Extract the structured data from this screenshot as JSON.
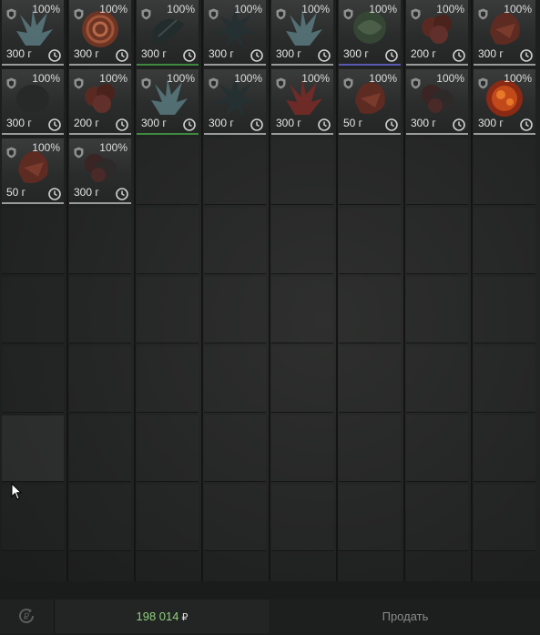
{
  "inventory": {
    "columns": 8,
    "rows": 8,
    "items": [
      {
        "condition": "100%",
        "weight": "300 г",
        "art": "blue-crystal-icon",
        "border": "white"
      },
      {
        "condition": "100%",
        "weight": "300 г",
        "art": "spiral-shell-icon",
        "border": "white"
      },
      {
        "condition": "100%",
        "weight": "300 г",
        "art": "dark-fern-icon",
        "border": "green"
      },
      {
        "condition": "100%",
        "weight": "300 г",
        "art": "dark-spiky-icon",
        "border": "white"
      },
      {
        "condition": "100%",
        "weight": "300 г",
        "art": "blue-crystal-icon",
        "border": "white"
      },
      {
        "condition": "100%",
        "weight": "300 г",
        "art": "green-orb-icon",
        "border": "blue"
      },
      {
        "condition": "100%",
        "weight": "200 г",
        "art": "red-cluster-icon",
        "border": "white"
      },
      {
        "condition": "100%",
        "weight": "300 г",
        "art": "red-rock-icon",
        "border": "white"
      },
      {
        "condition": "100%",
        "weight": "300 г",
        "art": "dark-blob-icon",
        "border": "white"
      },
      {
        "condition": "100%",
        "weight": "200 г",
        "art": "red-cluster-icon",
        "border": "white"
      },
      {
        "condition": "100%",
        "weight": "300 г",
        "art": "blue-crystal-icon",
        "border": "green"
      },
      {
        "condition": "100%",
        "weight": "300 г",
        "art": "dark-spiky-icon",
        "border": "white"
      },
      {
        "condition": "100%",
        "weight": "300 г",
        "art": "red-crystal-icon",
        "border": "white"
      },
      {
        "condition": "100%",
        "weight": "50 г",
        "art": "red-rock-icon",
        "border": "white"
      },
      {
        "condition": "100%",
        "weight": "300 г",
        "art": "dark-cluster-icon",
        "border": "white"
      },
      {
        "condition": "100%",
        "weight": "300 г",
        "art": "fire-orb-icon",
        "border": "white"
      },
      {
        "condition": "100%",
        "weight": "50 г",
        "art": "red-rock-icon",
        "border": "white"
      },
      {
        "condition": "100%",
        "weight": "300 г",
        "art": "dark-cluster-icon",
        "border": "white"
      }
    ]
  },
  "icons": {
    "condition": "shield-icon",
    "time": "clock-icon",
    "refresh": "refresh-currency-icon"
  },
  "footer": {
    "balance": "198 014",
    "currency": "₽",
    "sell_label": "Продать"
  },
  "colors": {
    "balance": "#8fd07d",
    "panel": "#1c1d1d"
  }
}
